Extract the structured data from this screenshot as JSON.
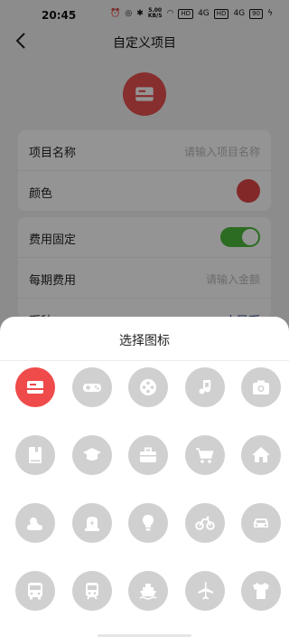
{
  "status_bar": {
    "time": "20:45",
    "speed_value": "5.00",
    "speed_unit": "KB/S",
    "hd1": "HD",
    "hd2": "HD",
    "signal1": "4G",
    "signal2": "4G",
    "battery": "90"
  },
  "nav": {
    "title": "自定义项目"
  },
  "form": {
    "name_label": "项目名称",
    "name_placeholder": "请输入项目名称",
    "color_label": "颜色",
    "color_value": "#e04545",
    "fixed_cost_label": "费用固定",
    "fixed_cost_on": true,
    "period_cost_label": "每期费用",
    "period_cost_placeholder": "请输入金额",
    "currency_label": "币种",
    "currency_value": "人民币"
  },
  "sheet": {
    "title": "选择图标",
    "selected_index": 0,
    "icons": [
      "card-icon",
      "gamepad-icon",
      "film-reel-icon",
      "music-icon",
      "camera-icon",
      "book-icon",
      "graduation-cap-icon",
      "briefcase-icon",
      "shopping-cart-icon",
      "home-icon",
      "weather-icon",
      "alarm-light-icon",
      "lightbulb-icon",
      "bicycle-icon",
      "car-icon",
      "bus-icon",
      "train-icon",
      "ship-icon",
      "airplane-icon",
      "tshirt-icon"
    ]
  },
  "colors": {
    "accent": "#ef4b4b",
    "icon_bg": "#d0d0d0",
    "toggle_on": "#4cbb3c"
  }
}
